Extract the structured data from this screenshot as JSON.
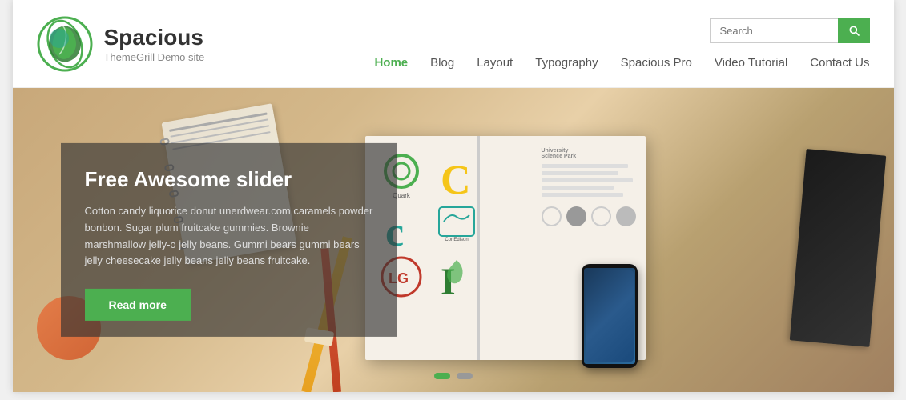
{
  "site": {
    "title": "Spacious",
    "tagline": "ThemeGrill Demo site",
    "logo_alt": "Spacious Logo"
  },
  "search": {
    "placeholder": "Search",
    "button_aria": "Search"
  },
  "nav": {
    "items": [
      {
        "label": "Home",
        "active": true
      },
      {
        "label": "Blog",
        "active": false
      },
      {
        "label": "Layout",
        "active": false
      },
      {
        "label": "Typography",
        "active": false
      },
      {
        "label": "Spacious Pro",
        "active": false
      },
      {
        "label": "Video Tutorial",
        "active": false
      },
      {
        "label": "Contact Us",
        "active": false
      }
    ]
  },
  "hero": {
    "title": "Free Awesome slider",
    "body": "Cotton candy liquorice donut unerdwear.com caramels powder bonbon. Sugar plum fruitcake gummies. Brownie marshmallow jelly-o jelly beans. Gummi bears gummi bears jelly cheesecake jelly beans jelly beans fruitcake.",
    "cta_label": "Read more",
    "dots": [
      {
        "active": true
      },
      {
        "active": false
      }
    ]
  },
  "colors": {
    "accent": "#4caf50",
    "dark": "#333333",
    "light_text": "#888888"
  }
}
